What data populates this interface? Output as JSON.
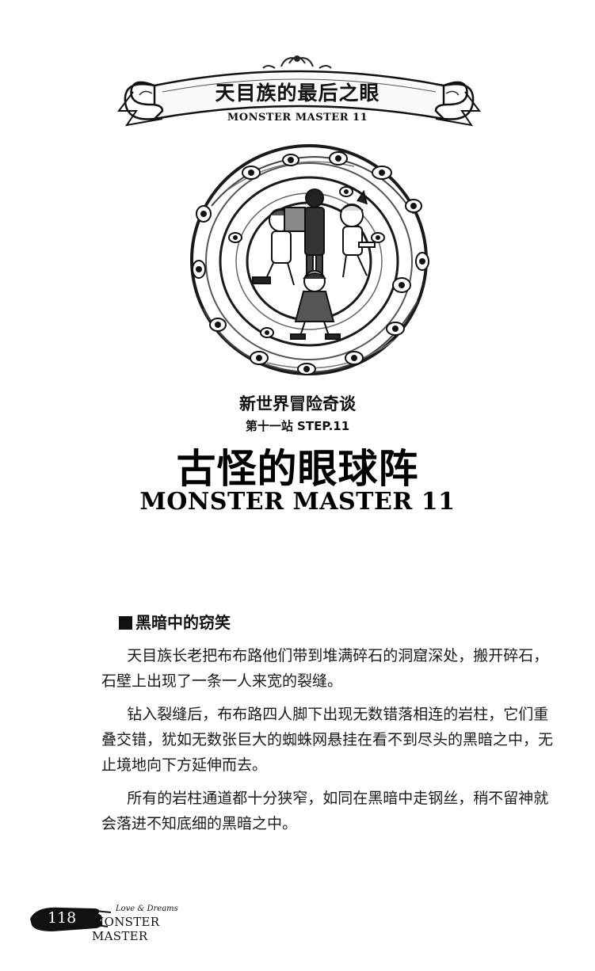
{
  "banner": {
    "title": "天目族的最后之眼",
    "subtitle": "MONSTER MASTER 11"
  },
  "chapter": {
    "series": "新世界冒险奇谈",
    "step": "第十一站 STEP.11",
    "title": "古怪的眼球阵",
    "subtitle": "MONSTER MASTER 11"
  },
  "section": {
    "heading": "黑暗中的窃笑",
    "paragraphs": [
      "天目族长老把布布路他们带到堆满碎石的洞窟深处，搬开碎石，石壁上出现了一条一人来宽的裂缝。",
      "钻入裂缝后，布布路四人脚下出现无数错落相连的岩柱，它们重叠交错，犹如无数张巨大的蜘蛛网悬挂在看不到尽头的黑暗之中，无止境地向下方延伸而去。",
      "所有的岩柱通道都十分狭窄，如同在黑暗中走钢丝，稍不留神就会落进不知底细的黑暗之中。"
    ]
  },
  "footer": {
    "page_number": "118",
    "tagline": "Love & Dreams",
    "series": "MONSTER MASTER"
  }
}
